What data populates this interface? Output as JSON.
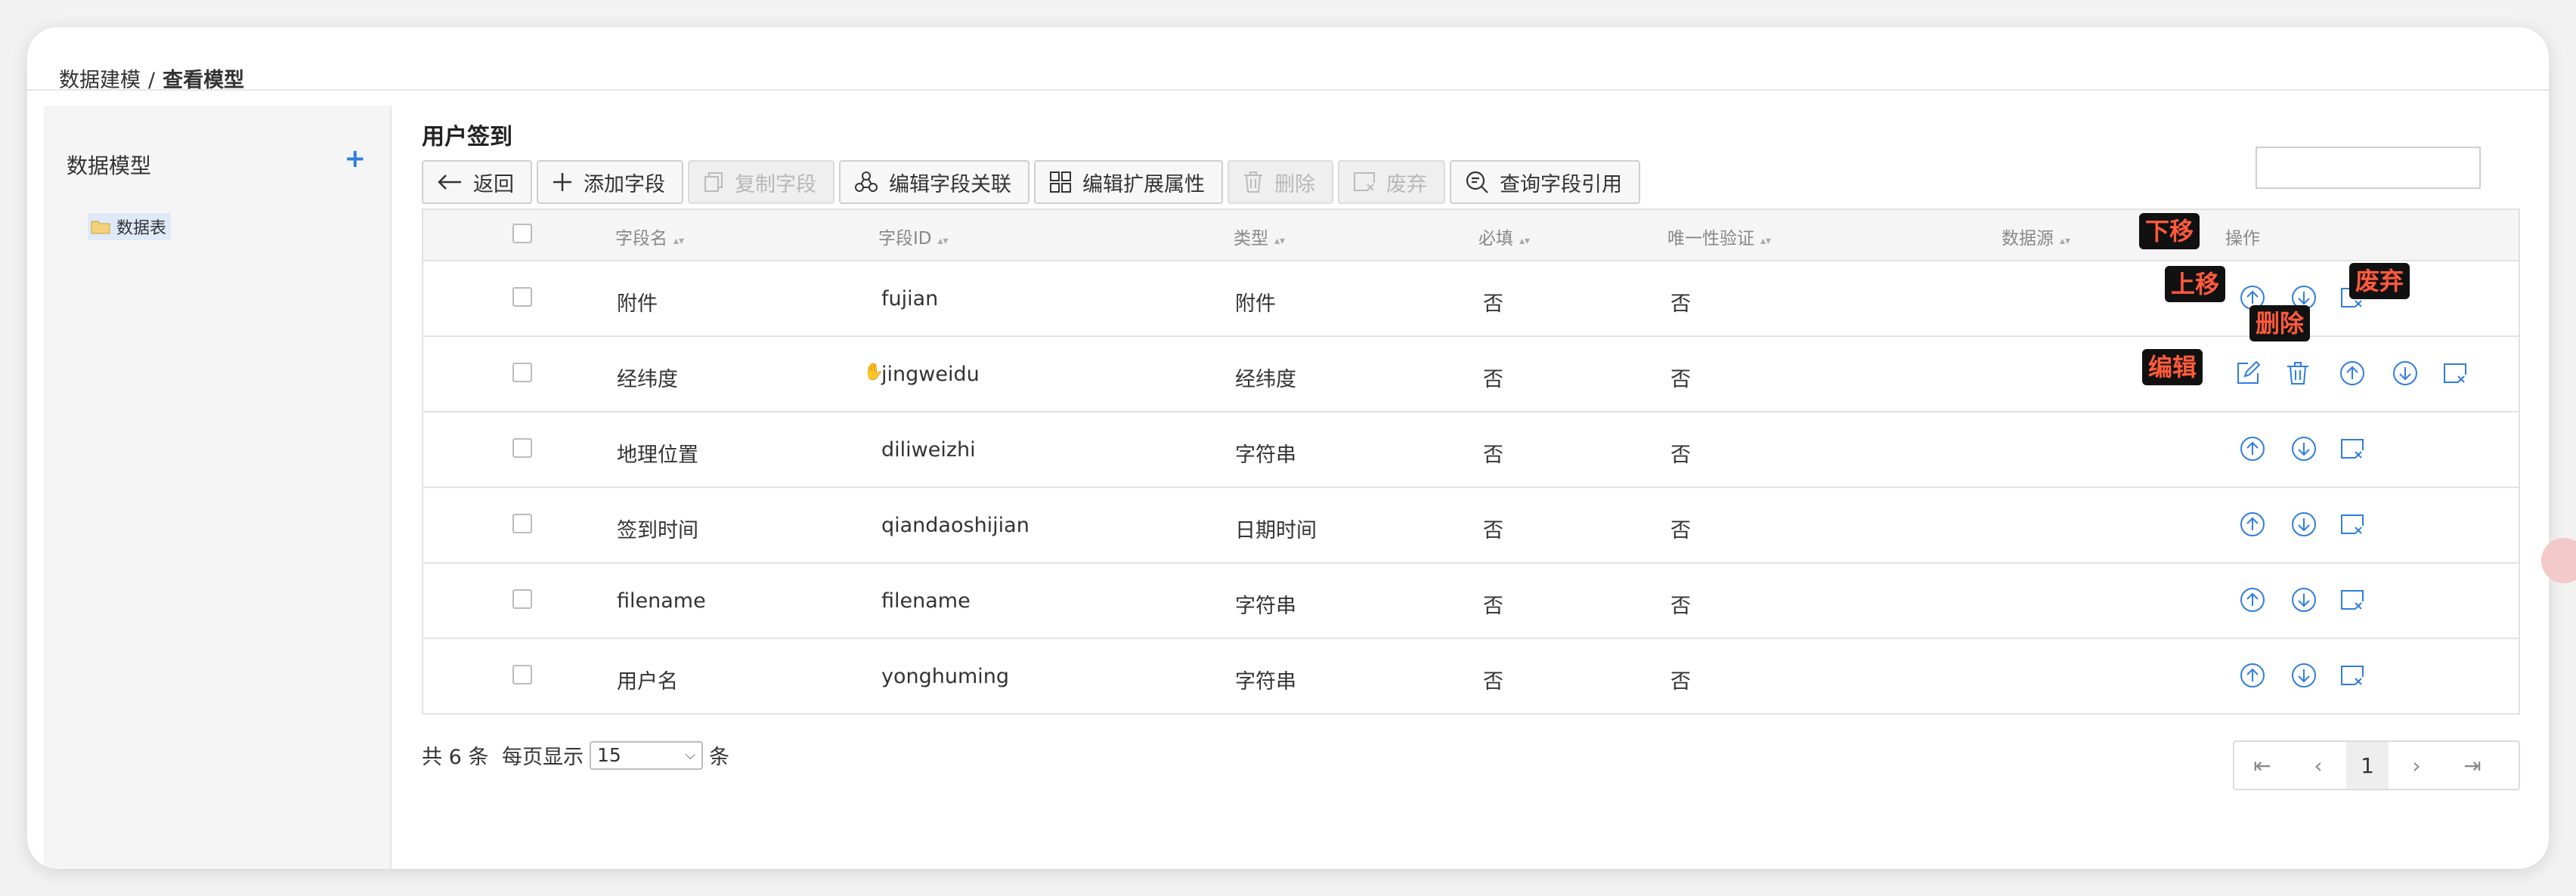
{
  "breadcrumb": {
    "parent": "数据建模",
    "separator": "/",
    "current": "查看模型"
  },
  "sidebar": {
    "title": "数据模型",
    "add_icon": "plus-icon",
    "tree": [
      {
        "label": "数据表",
        "icon": "folder-icon"
      }
    ]
  },
  "main": {
    "title": "用户签到",
    "toolbar": [
      {
        "label": "返回",
        "icon": "arrow-left-icon",
        "disabled": false
      },
      {
        "label": "添加字段",
        "icon": "plus-icon",
        "disabled": false
      },
      {
        "label": "复制字段",
        "icon": "copy-icon",
        "disabled": true
      },
      {
        "label": "编辑字段关联",
        "icon": "link-icon",
        "disabled": false
      },
      {
        "label": "编辑扩展属性",
        "icon": "grid-icon",
        "disabled": false
      },
      {
        "label": "删除",
        "icon": "trash-icon",
        "disabled": true
      },
      {
        "label": "废弃",
        "icon": "discard-icon",
        "disabled": true
      },
      {
        "label": "查询字段引用",
        "icon": "search-doc-icon",
        "disabled": false
      }
    ],
    "search": {
      "placeholder": ""
    }
  },
  "table": {
    "columns": [
      "字段名",
      "字段ID",
      "类型",
      "必填",
      "唯一性验证",
      "数据源",
      "操作"
    ],
    "sort_icon": "sort-icon",
    "rows": [
      {
        "name": "附件",
        "id": "fujian",
        "type": "附件",
        "required": "否",
        "unique": "否",
        "source": ""
      },
      {
        "name": "经纬度",
        "id": "jingweidu",
        "type": "经纬度",
        "required": "否",
        "unique": "否",
        "source": ""
      },
      {
        "name": "地理位置",
        "id": "diliweizhi",
        "type": "字符串",
        "required": "否",
        "unique": "否",
        "source": ""
      },
      {
        "name": "签到时间",
        "id": "qiandaoshijian",
        "type": "日期时间",
        "required": "否",
        "unique": "否",
        "source": ""
      },
      {
        "name": "filename",
        "id": "filename",
        "type": "字符串",
        "required": "否",
        "unique": "否",
        "source": ""
      },
      {
        "name": "用户名",
        "id": "yonghuming",
        "type": "字符串",
        "required": "否",
        "unique": "否",
        "source": ""
      }
    ]
  },
  "annotations": {
    "move_up": "上移",
    "move_down": "下移",
    "discard": "废弃",
    "delete": "删除",
    "edit": "编辑"
  },
  "footer": {
    "total": "共 6 条",
    "per_page_label": "每页显示",
    "per_page_value": "15",
    "per_page_unit": "条",
    "current_page": "1"
  },
  "colors": {
    "accent": "#2f7de1",
    "annotation_text": "#ff5a3c",
    "annotation_bg": "#111111"
  }
}
